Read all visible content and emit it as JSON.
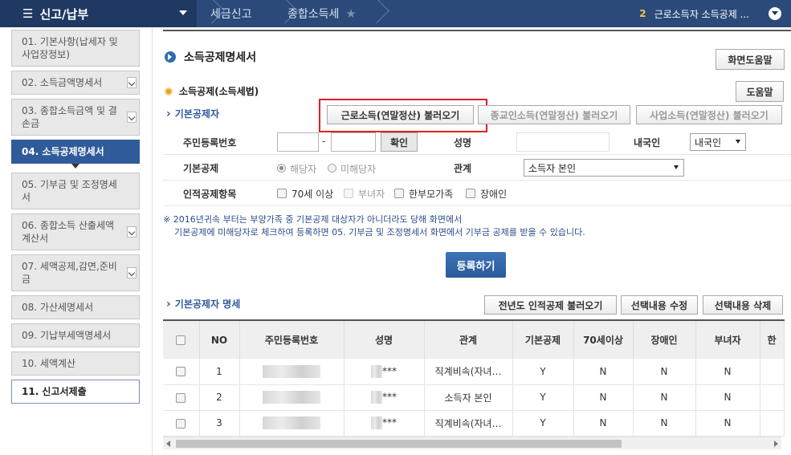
{
  "topbar": {
    "menu_icon": "hamburger-icon",
    "menu_title": "신고/납부",
    "breadcrumb": [
      "세금신고",
      "종합소득세"
    ],
    "step_num": "2",
    "step_text": "근로소득자 소득공제 ...",
    "accent": "#2b4a7a"
  },
  "sidebar": {
    "items": [
      {
        "label": "01.  기본사항(납세자 및 사업장정보)"
      },
      {
        "label": "02.  소득금액명세서"
      },
      {
        "label": "03.  종합소득금액 및 결손금"
      },
      {
        "label": "04.  소득공제명세서"
      },
      {
        "label": "05.  기부금 및 조정명세서"
      },
      {
        "label": "06.  종합소득 산출세액계산서"
      },
      {
        "label": "07.  세액공제,감면,준비금"
      },
      {
        "label": "08.  가산세명세서"
      },
      {
        "label": "09.  기납부세액명세서"
      },
      {
        "label": "10.  세액계산"
      },
      {
        "label": "11.  신고서제출"
      }
    ]
  },
  "main": {
    "title": "소득공제명세서",
    "help_screen": "화면도움말",
    "section": "소득공제(소득세법)",
    "help": "도움말",
    "sub_basic": "기본공제자",
    "load_buttons": [
      "근로소득(연말정산) 불러오기",
      "종교인소득(연말정산) 불러오기",
      "사업소득(연말정산) 불러오기"
    ],
    "form": {
      "rrn_label": "주민등록번호",
      "dash": "-",
      "confirm": "확인",
      "name_label": "성명",
      "nation_label": "내국인",
      "nation_value": "내국인",
      "basic_label": "기본공제",
      "radio_yes": "해당자",
      "radio_no": "미해당자",
      "relation_label": "관계",
      "relation_value": "소득자 본인",
      "personal_label": "인적공제항목",
      "checks": [
        "70세 이상",
        "부녀자",
        "한부모가족",
        "장애인"
      ]
    },
    "note_line1": "※ 2016년귀속 부터는 부양가족 중 기본공제 대상자가 아니더라도 당해 화면에서",
    "note_line2": "기본공제에 미해당자로 체크하여 등록하면 05. 기부금 및 조정명세서 화면에서 기부금 공제를 받을 수 있습니다.",
    "register": "등록하기",
    "list_title": "기본공제자 명세",
    "list_buttons": [
      "전년도 인적공제 불러오기",
      "선택내용 수정",
      "선택내용 삭제"
    ],
    "table": {
      "headers": [
        "",
        "NO",
        "주민등록번호",
        "성명",
        "관계",
        "기본공제",
        "70세이상",
        "장애인",
        "부녀자",
        "한"
      ],
      "rows": [
        {
          "no": "1",
          "name": "***",
          "relation": "직계비속(자녀…",
          "basic": "Y",
          "over70": "N",
          "disabled": "N",
          "woman": "N"
        },
        {
          "no": "2",
          "name": "***",
          "relation": "소득자 본인",
          "basic": "Y",
          "over70": "N",
          "disabled": "N",
          "woman": "N"
        },
        {
          "no": "3",
          "name": "***",
          "relation": "직계비속(자녀…",
          "basic": "Y",
          "over70": "N",
          "disabled": "N",
          "woman": "N"
        }
      ]
    }
  }
}
